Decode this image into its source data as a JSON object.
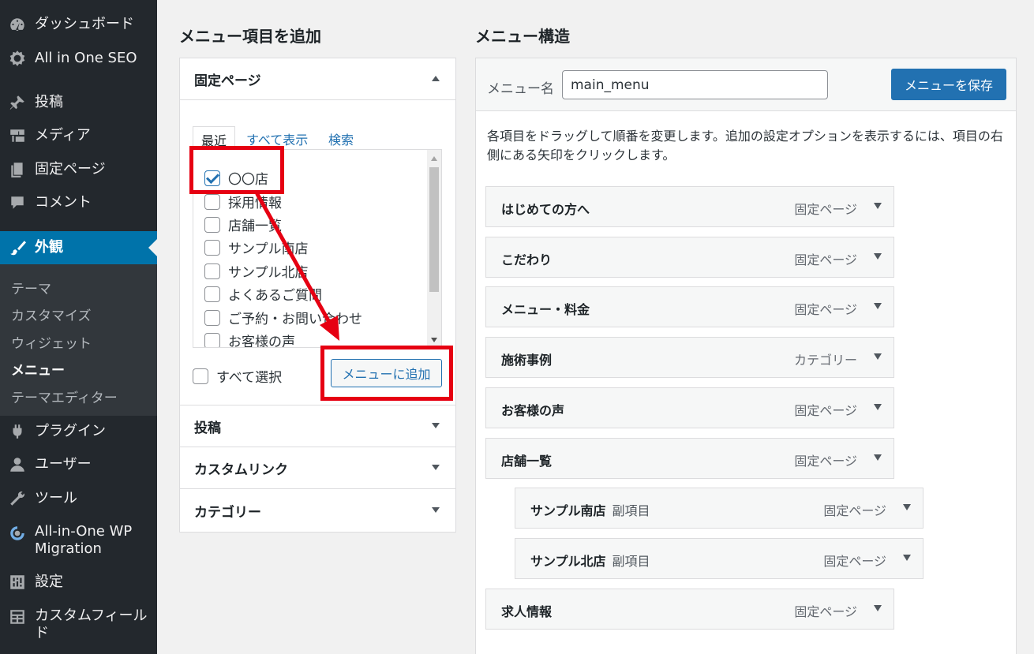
{
  "sidebar": {
    "items": [
      {
        "label": "ダッシュボード",
        "icon": "dashboard-icon"
      },
      {
        "label": "All in One SEO",
        "icon": "seo-gear-icon"
      },
      {
        "label": "投稿",
        "icon": "pin-icon"
      },
      {
        "label": "メディア",
        "icon": "media-icon"
      },
      {
        "label": "固定ページ",
        "icon": "page-icon"
      },
      {
        "label": "コメント",
        "icon": "comment-icon"
      },
      {
        "label": "外観",
        "icon": "brush-icon"
      },
      {
        "label": "プラグイン",
        "icon": "plugin-icon"
      },
      {
        "label": "ユーザー",
        "icon": "user-icon"
      },
      {
        "label": "ツール",
        "icon": "wrench-icon"
      },
      {
        "label": "All-in-One WP Migration",
        "icon": "migration-icon"
      },
      {
        "label": "設定",
        "icon": "settings-icon"
      },
      {
        "label": "カスタムフィールド",
        "icon": "custom-fields-icon"
      }
    ],
    "submenu": [
      "テーマ",
      "カスタマイズ",
      "ウィジェット",
      "メニュー",
      "テーマエディター"
    ]
  },
  "left": {
    "heading": "メニュー項目を追加",
    "sections": [
      {
        "label": "固定ページ"
      },
      {
        "label": "投稿"
      },
      {
        "label": "カスタムリンク"
      },
      {
        "label": "カテゴリー"
      }
    ],
    "tabs": [
      "最近",
      "すべて表示",
      "検索"
    ],
    "pages": [
      {
        "label": "〇〇店",
        "checked": true
      },
      {
        "label": "採用情報",
        "checked": false
      },
      {
        "label": "店舗一覧",
        "checked": false
      },
      {
        "label": "サンプル南店",
        "checked": false
      },
      {
        "label": "サンプル北店",
        "checked": false
      },
      {
        "label": "よくあるご質問",
        "checked": false
      },
      {
        "label": "ご予約・お問い合わせ",
        "checked": false
      },
      {
        "label": "お客様の声",
        "checked": false
      }
    ],
    "select_all": "すべて選択",
    "add_button": "メニューに追加"
  },
  "right": {
    "heading": "メニュー構造",
    "menu_name_label": "メニュー名",
    "menu_name_value": "main_menu",
    "save_button": "メニューを保存",
    "instructions": "各項目をドラッグして順番を変更します。追加の設定オプションを表示するには、項目の右側にある矢印をクリックします。",
    "items": [
      {
        "title": "はじめての方へ",
        "type": "固定ページ",
        "sub": ""
      },
      {
        "title": "こだわり",
        "type": "固定ページ",
        "sub": ""
      },
      {
        "title": "メニュー・料金",
        "type": "固定ページ",
        "sub": ""
      },
      {
        "title": "施術事例",
        "type": "カテゴリー",
        "sub": ""
      },
      {
        "title": "お客様の声",
        "type": "固定ページ",
        "sub": ""
      },
      {
        "title": "店舗一覧",
        "type": "固定ページ",
        "sub": ""
      },
      {
        "title": "サンプル南店",
        "type": "固定ページ",
        "sub": "副項目"
      },
      {
        "title": "サンプル北店",
        "type": "固定ページ",
        "sub": "副項目"
      },
      {
        "title": "求人情報",
        "type": "固定ページ",
        "sub": ""
      }
    ]
  },
  "colors": {
    "sidebar_bg": "#23282d",
    "active": "#0073aa",
    "primary": "#2271b1",
    "annotation": "#e60012"
  }
}
